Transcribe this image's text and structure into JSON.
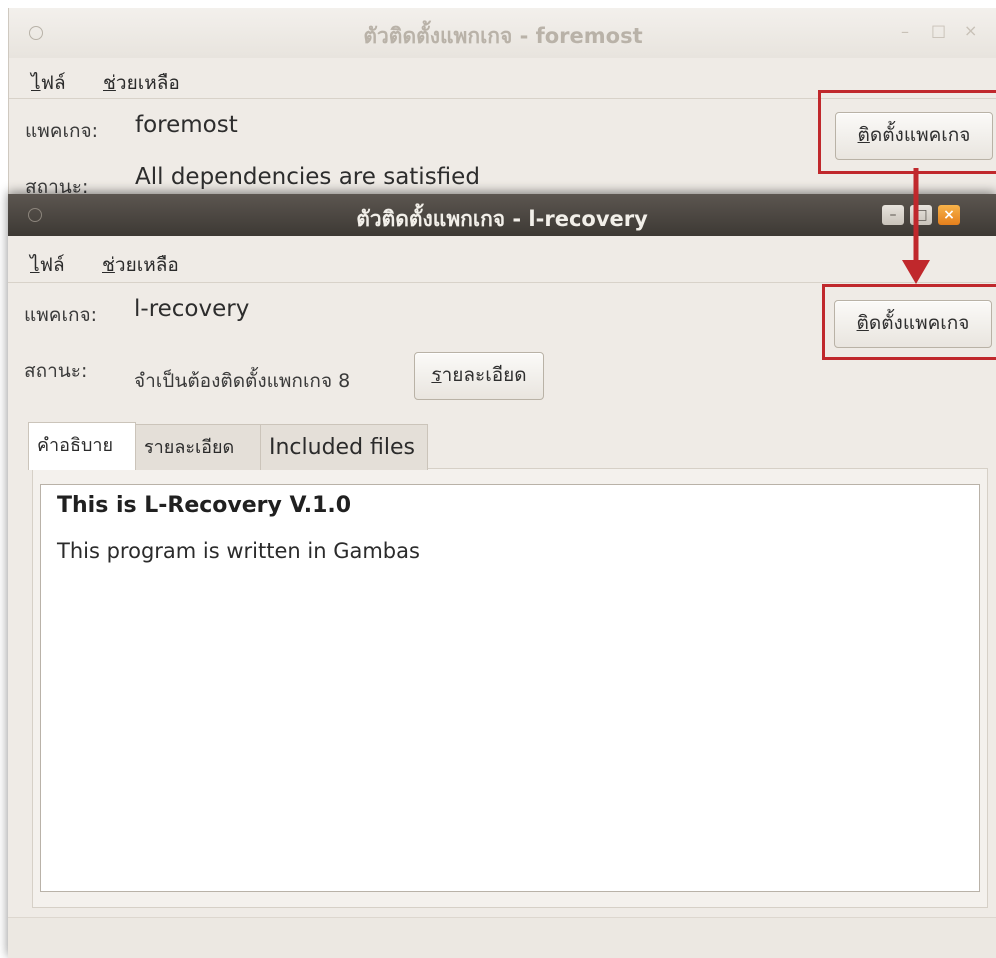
{
  "back_window": {
    "title": "ตัวติดตั้งแพกเกจ - foremost",
    "menu": [
      {
        "prefix": "",
        "mnemonic": "ไ",
        "rest": "ฟล์"
      },
      {
        "prefix": "",
        "mnemonic": "ช",
        "rest": "่วยเหลือ"
      }
    ],
    "package_label": "แพคเกจ:",
    "package_value": "foremost",
    "status_label": "สถานะ:",
    "status_value": "All dependencies are satisfied",
    "install_button": {
      "mnemonic": "ติ",
      "rest": "ดตั้งแพคเกจ"
    },
    "window_controls": {
      "minimize": "–",
      "maximize": "□",
      "close": "×"
    }
  },
  "front_window": {
    "title": "ตัวติดตั้งแพกเกจ - l-recovery",
    "menu": [
      {
        "mnemonic": "ไ",
        "rest": "ฟล์"
      },
      {
        "mnemonic": "ช",
        "rest": "่วยเหลือ"
      }
    ],
    "package_label": "แพคเกจ:",
    "package_value": "l-recovery",
    "status_label": "สถานะ:",
    "status_value": "จำเป็นต้องติดตั้งแพกเกจ 8",
    "details_button": {
      "mnemonic": "ร",
      "rest": "ายละเอียด"
    },
    "install_button": {
      "mnemonic": "ติ",
      "rest": "ดตั้งแพคเกจ"
    },
    "window_controls": {
      "minimize": "–",
      "maximize": "□",
      "close": "×"
    },
    "tabs": [
      "คำอธิบาย",
      "รายละเอียด",
      "Included files"
    ],
    "description_heading": "This is L-Recovery V.1.0",
    "description_body": "This program is written in Gambas"
  },
  "annotation": {
    "highlight_color": "#c0282c"
  }
}
